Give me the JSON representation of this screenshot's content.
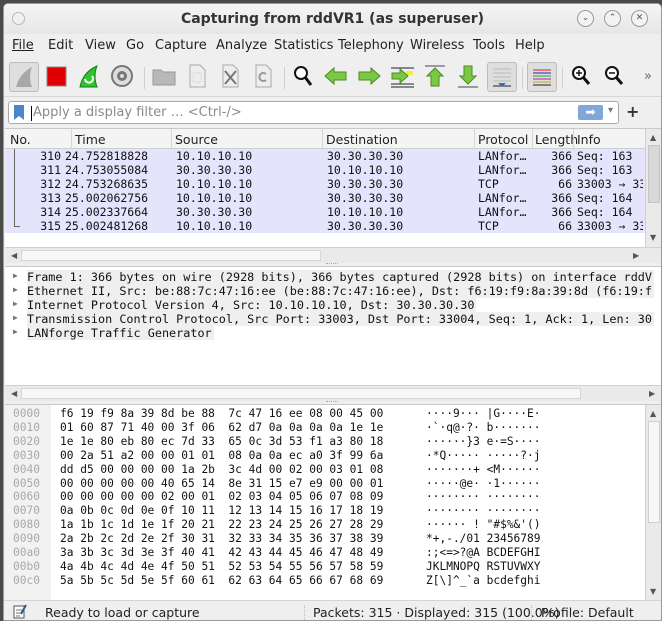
{
  "window": {
    "title": "Capturing from rddVR1 (as superuser)",
    "controls": {
      "minimize": "⌄",
      "maximize": "⌃",
      "close": "✕"
    }
  },
  "menu": [
    "File",
    "Edit",
    "View",
    "Go",
    "Capture",
    "Analyze",
    "Statistics",
    "Telephony",
    "Wireless",
    "Tools",
    "Help"
  ],
  "toolbar": {
    "icons": [
      "start-capture-icon",
      "stop-capture-icon",
      "restart-capture-icon",
      "capture-options-icon",
      "open-file-icon",
      "save-file-icon",
      "close-file-icon",
      "reload-file-icon",
      "find-packet-icon",
      "go-back-icon",
      "go-forward-icon",
      "go-to-packet-icon",
      "go-first-icon",
      "go-last-icon",
      "autoscroll-icon",
      "colorize-icon",
      "zoom-in-icon",
      "zoom-out-icon"
    ],
    "overflow": "»"
  },
  "filter": {
    "placeholder": "Apply a display filter … <Ctrl-/>",
    "value": "",
    "apply_arrow": "➡",
    "dropdown": "▾",
    "add": "+"
  },
  "packet_list": {
    "columns": [
      "No.",
      "Time",
      "Source",
      "Destination",
      "Protocol",
      "Length",
      "Info"
    ],
    "rows": [
      {
        "no": "310",
        "time": "24.752818828",
        "src": "10.10.10.10",
        "dst": "30.30.30.30",
        "proto": "LANfor…",
        "len": "366",
        "info": "Seq: 163"
      },
      {
        "no": "311",
        "time": "24.753055084",
        "src": "30.30.30.30",
        "dst": "10.10.10.10",
        "proto": "LANfor…",
        "len": "366",
        "info": "Seq: 163"
      },
      {
        "no": "312",
        "time": "24.753268635",
        "src": "10.10.10.10",
        "dst": "30.30.30.30",
        "proto": "TCP",
        "len": "66",
        "info": "33003 → 33"
      },
      {
        "no": "313",
        "time": "25.002062756",
        "src": "10.10.10.10",
        "dst": "30.30.30.30",
        "proto": "LANfor…",
        "len": "366",
        "info": "Seq: 164"
      },
      {
        "no": "314",
        "time": "25.002337664",
        "src": "30.30.30.30",
        "dst": "10.10.10.10",
        "proto": "LANfor…",
        "len": "366",
        "info": "Seq: 164"
      },
      {
        "no": "315",
        "time": "25.002481268",
        "src": "10.10.10.10",
        "dst": "30.30.30.30",
        "proto": "TCP",
        "len": "66",
        "info": "33003 → 33"
      }
    ],
    "row_color": "#e4e4fc"
  },
  "details": [
    "Frame 1: 366 bytes on wire (2928 bits), 366 bytes captured (2928 bits) on interface rddV",
    "Ethernet II, Src: be:88:7c:47:16:ee (be:88:7c:47:16:ee), Dst: f6:19:f9:8a:39:8d (f6:19:f",
    "Internet Protocol Version 4, Src: 10.10.10.10, Dst: 30.30.30.30",
    "Transmission Control Protocol, Src Port: 33003, Dst Port: 33004, Seq: 1, Ack: 1, Len: 30",
    "LANforge Traffic Generator"
  ],
  "hex_dump": [
    {
      "offset": "0000",
      "bytes": "f6 19 f9 8a 39 8d be 88  7c 47 16 ee 08 00 45 00",
      "ascii": "····9··· |G····E·"
    },
    {
      "offset": "0010",
      "bytes": "01 60 87 71 40 00 3f 06  62 d7 0a 0a 0a 0a 1e 1e",
      "ascii": "·`·q@·?· b·······"
    },
    {
      "offset": "0020",
      "bytes": "1e 1e 80 eb 80 ec 7d 33  65 0c 3d 53 f1 a3 80 18",
      "ascii": "······}3 e·=S····"
    },
    {
      "offset": "0030",
      "bytes": "00 2a 51 a2 00 00 01 01  08 0a 0a ec a0 3f 99 6a",
      "ascii": "·*Q····· ·····?·j"
    },
    {
      "offset": "0040",
      "bytes": "dd d5 00 00 00 00 1a 2b  3c 4d 00 02 00 03 01 08",
      "ascii": "·······+ <M······"
    },
    {
      "offset": "0050",
      "bytes": "00 00 00 00 00 40 65 14  8e 31 15 e7 e9 00 00 01",
      "ascii": "·····@e· ·1······"
    },
    {
      "offset": "0060",
      "bytes": "00 00 00 00 00 02 00 01  02 03 04 05 06 07 08 09",
      "ascii": "········ ········"
    },
    {
      "offset": "0070",
      "bytes": "0a 0b 0c 0d 0e 0f 10 11  12 13 14 15 16 17 18 19",
      "ascii": "········ ········"
    },
    {
      "offset": "0080",
      "bytes": "1a 1b 1c 1d 1e 1f 20 21  22 23 24 25 26 27 28 29",
      "ascii": "······ ! \"#$%&'()"
    },
    {
      "offset": "0090",
      "bytes": "2a 2b 2c 2d 2e 2f 30 31  32 33 34 35 36 37 38 39",
      "ascii": "*+,-./01 23456789"
    },
    {
      "offset": "00a0",
      "bytes": "3a 3b 3c 3d 3e 3f 40 41  42 43 44 45 46 47 48 49",
      "ascii": ":;<=>?@A BCDEFGHI"
    },
    {
      "offset": "00b0",
      "bytes": "4a 4b 4c 4d 4e 4f 50 51  52 53 54 55 56 57 58 59",
      "ascii": "JKLMNOPQ RSTUVWXY"
    },
    {
      "offset": "00c0",
      "bytes": "5a 5b 5c 5d 5e 5f 60 61  62 63 64 65 66 67 68 69",
      "ascii": "Z[\\]^_`a bcdefghi"
    }
  ],
  "status": {
    "ready": "Ready to load or capture",
    "packets": "Packets: 315 · Displayed: 315 (100.0%)",
    "profile": "Profile: Default"
  }
}
